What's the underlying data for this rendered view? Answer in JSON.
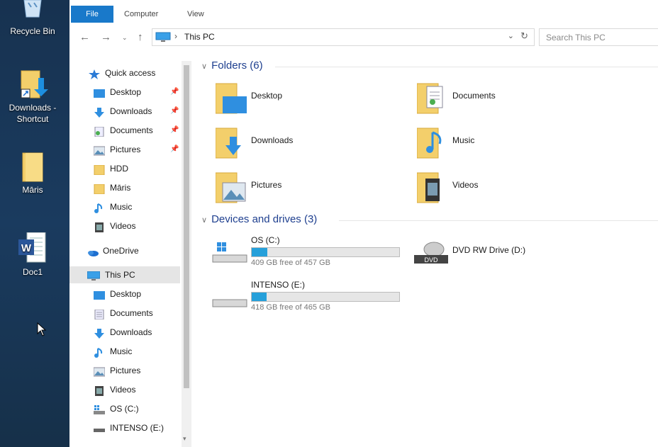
{
  "desktop": {
    "icons": [
      {
        "label": "Recycle Bin"
      },
      {
        "label": "Downloads - Shortcut"
      },
      {
        "label": "Māris"
      },
      {
        "label": "Doc1"
      }
    ]
  },
  "ribbon": {
    "tabs": [
      "File",
      "Computer",
      "View"
    ]
  },
  "address": {
    "path": "This PC",
    "search_placeholder": "Search This PC"
  },
  "nav": {
    "quick_access": "Quick access",
    "quick_items": [
      {
        "label": "Desktop",
        "pinned": true
      },
      {
        "label": "Downloads",
        "pinned": true
      },
      {
        "label": "Documents",
        "pinned": true
      },
      {
        "label": "Pictures",
        "pinned": true
      },
      {
        "label": "HDD",
        "pinned": false
      },
      {
        "label": "Māris",
        "pinned": false
      },
      {
        "label": "Music",
        "pinned": false
      },
      {
        "label": "Videos",
        "pinned": false
      }
    ],
    "onedrive": "OneDrive",
    "this_pc": "This PC",
    "pc_items": [
      "Desktop",
      "Documents",
      "Downloads",
      "Music",
      "Pictures",
      "Videos",
      "OS (C:)",
      "INTENSO (E:)"
    ]
  },
  "content": {
    "folders_header": "Folders (6)",
    "folders": [
      "Desktop",
      "Documents",
      "Downloads",
      "Music",
      "Pictures",
      "Videos"
    ],
    "devices_header": "Devices and drives (3)",
    "drives": [
      {
        "name": "OS (C:)",
        "free": "409 GB free of 457 GB",
        "used_fraction": 0.105
      },
      {
        "name": "INTENSO (E:)",
        "free": "418 GB free of 465 GB",
        "used_fraction": 0.101
      }
    ],
    "dvd": {
      "name": "DVD RW Drive (D:)",
      "badge": "DVD"
    }
  },
  "colors": {
    "accent": "#1979ca",
    "progress": "#26a0da",
    "group_header": "#1e3f8f"
  }
}
